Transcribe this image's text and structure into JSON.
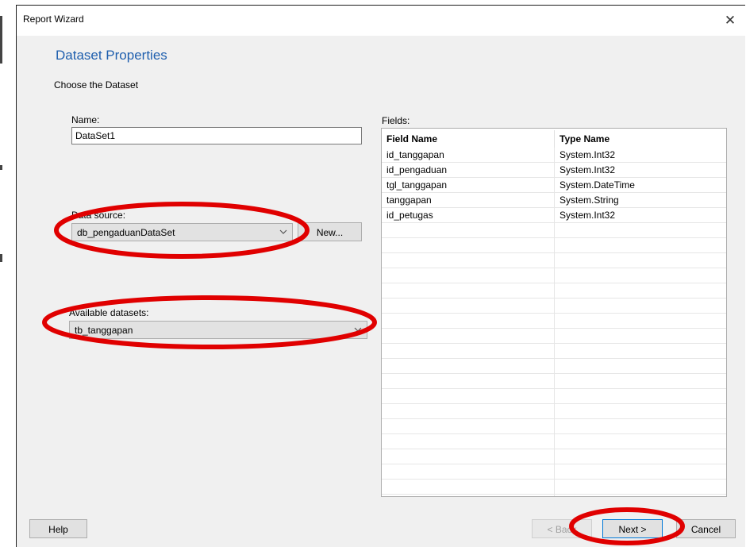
{
  "window": {
    "title": "Report Wizard",
    "close_glyph": "✕"
  },
  "page": {
    "heading": "Dataset Properties",
    "subheading": "Choose the Dataset"
  },
  "form": {
    "name_label": "Name:",
    "name_value": "DataSet1",
    "data_source_label": "Data source:",
    "data_source_value": "db_pengaduanDataSet",
    "new_button": "New...",
    "available_label": "Available datasets:",
    "available_value": "tb_tanggapan"
  },
  "fields": {
    "label": "Fields:",
    "columns": [
      "Field Name",
      "Type Name"
    ],
    "rows": [
      [
        "id_tanggapan",
        "System.Int32"
      ],
      [
        "id_pengaduan",
        "System.Int32"
      ],
      [
        "tgl_tanggapan",
        "System.DateTime"
      ],
      [
        "tanggapan",
        "System.String"
      ],
      [
        "id_petugas",
        "System.Int32"
      ]
    ]
  },
  "footer": {
    "help": "Help",
    "back": "< Back",
    "next": "Next >",
    "cancel": "Cancel"
  },
  "colors": {
    "accent": "#1f5fae",
    "annotation": "#e00000",
    "dialog_bg": "#f0f0f0",
    "focus_border": "#0078d7"
  },
  "icons": {
    "close": "close-icon",
    "dropdown": "chevron-down-icon"
  }
}
